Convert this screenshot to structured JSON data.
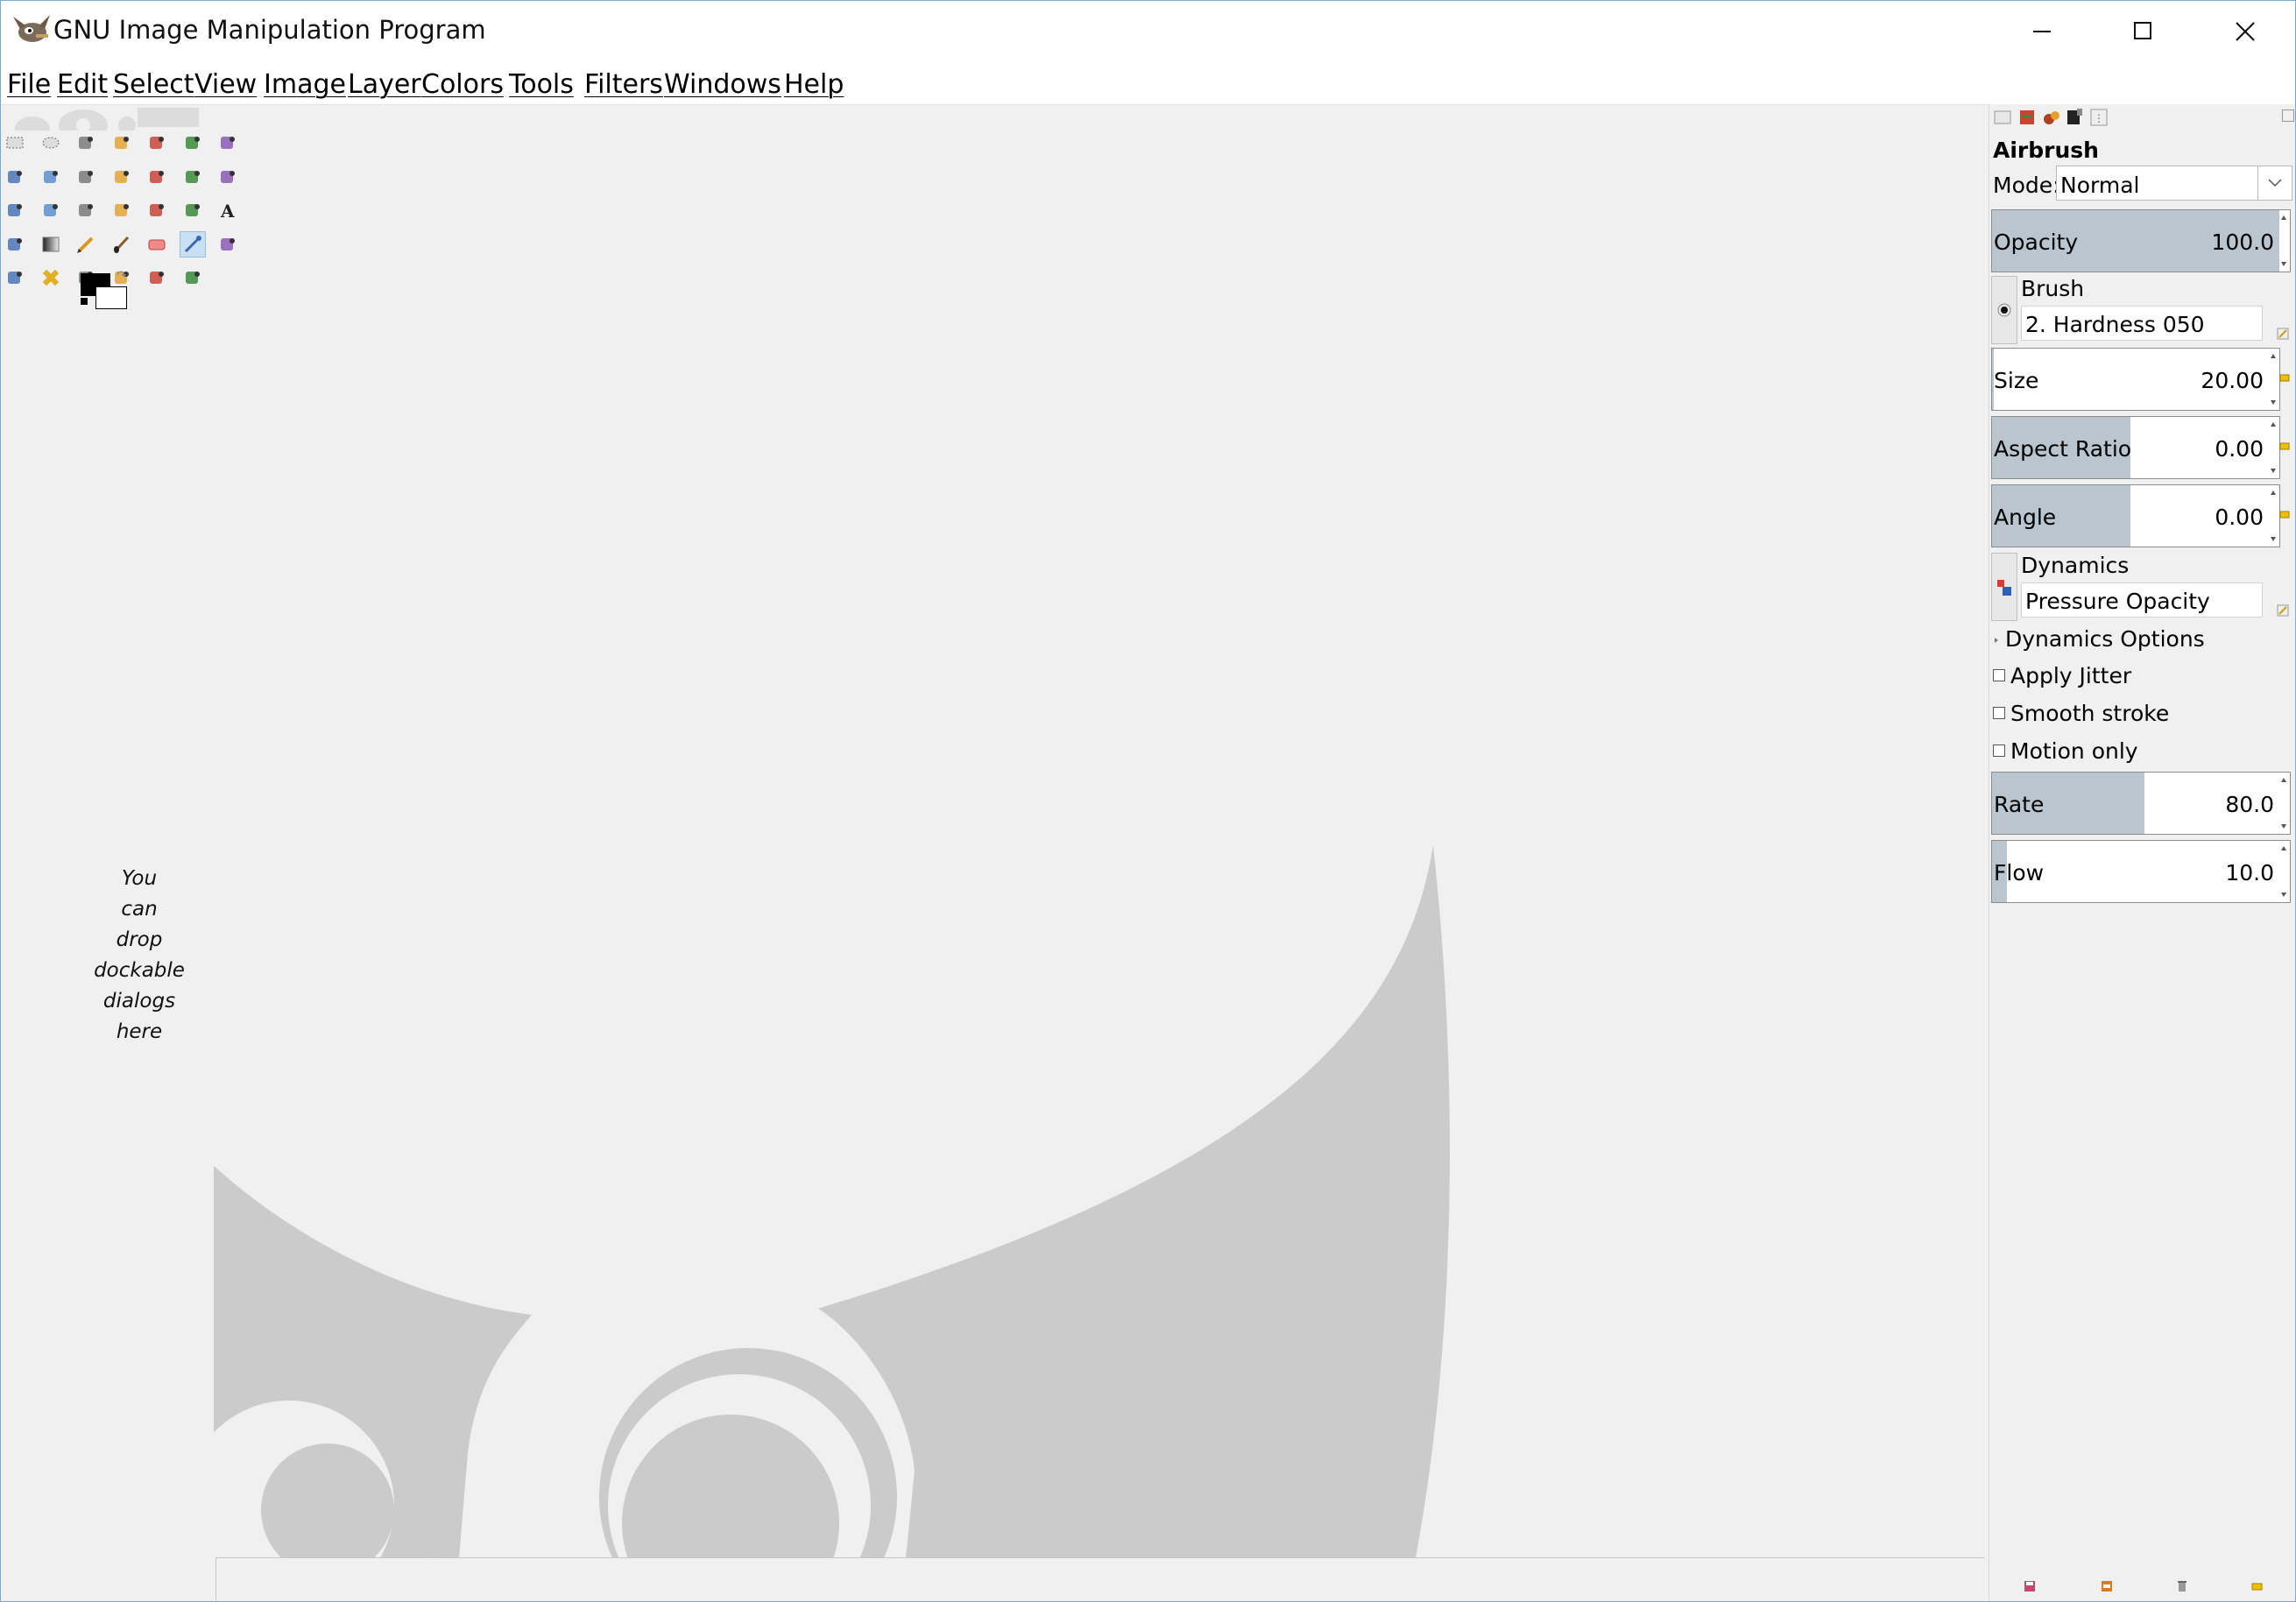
{
  "window": {
    "title": "GNU Image Manipulation Program"
  },
  "menu": {
    "items": [
      "File",
      "Edit",
      "Select",
      "View",
      "Image",
      "Layer",
      "Colors",
      "Tools",
      "Filters",
      "Windows",
      "Help"
    ]
  },
  "toolbox": {
    "tools": [
      "rect-select-icon",
      "ellipse-select-icon",
      "free-select-icon",
      "fuzzy-select-icon",
      "select-by-color-icon",
      "scissors-select-icon",
      "foreground-select-icon",
      "paths-icon",
      "color-picker-icon",
      "zoom-icon",
      "measure-icon",
      "move-icon",
      "align-icon",
      "crop-icon",
      "rotate-icon",
      "scale-icon",
      "shear-icon",
      "perspective-icon",
      "unified-transform-icon",
      "cage-transform-icon",
      "text-icon",
      "bucket-fill-icon",
      "gradient-icon",
      "pencil-icon",
      "paintbrush-icon",
      "eraser-icon",
      "airbrush-icon",
      "ink-icon",
      "clone-icon",
      "heal-icon",
      "perspective-clone-icon",
      "blur-icon",
      "smudge-icon",
      "dodge-burn-icon"
    ],
    "active_tool": "airbrush-icon",
    "drop_hint": [
      "You",
      "can",
      "drop",
      "dockable",
      "dialogs",
      "here"
    ]
  },
  "colors": {
    "foreground": "#000000",
    "background": "#ffffff",
    "slider_fill": "#b9c5cf",
    "wilber_gray": "#cbcbcb"
  },
  "tool_options": {
    "title": "Airbrush",
    "mode_label": "Mode:",
    "mode_value": "Normal",
    "opacity": {
      "label": "Opacity",
      "value": "100.0",
      "fraction": 1.0
    },
    "brush": {
      "label": "Brush",
      "value": "2. Hardness 050"
    },
    "size": {
      "label": "Size",
      "value": "20.00",
      "fraction": 0.005
    },
    "aspect_ratio": {
      "label": "Aspect Ratio",
      "value": "0.00",
      "fraction": 0.5
    },
    "angle": {
      "label": "Angle",
      "value": "0.00",
      "fraction": 0.5
    },
    "dynamics": {
      "label": "Dynamics",
      "value": "Pressure Opacity"
    },
    "dynamics_options_label": "Dynamics Options",
    "apply_jitter": {
      "label": "Apply Jitter",
      "checked": false
    },
    "smooth_stroke": {
      "label": "Smooth stroke",
      "checked": false
    },
    "motion_only": {
      "label": "Motion only",
      "checked": false
    },
    "rate": {
      "label": "Rate",
      "value": "80.0",
      "fraction": 0.53
    },
    "flow": {
      "label": "Flow",
      "value": "10.0",
      "fraction": 0.053
    }
  }
}
